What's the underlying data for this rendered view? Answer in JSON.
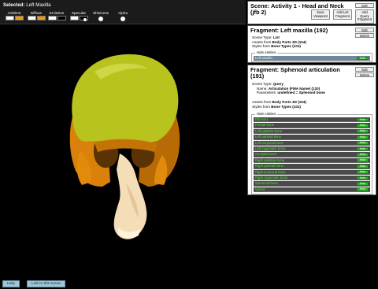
{
  "toolbar": {
    "selected_label": "Selected:",
    "selected_value": "Left Maxilla",
    "materials": [
      {
        "label": "Ambient",
        "colors": [
          "#ffffff",
          "#e99a1b"
        ],
        "has_knob": false
      },
      {
        "label": "Diffuse",
        "colors": [
          "#ffffff",
          "#e99a1b"
        ],
        "has_knob": false
      },
      {
        "label": "Emissive",
        "colors": [
          "#ffffff",
          "#000000"
        ],
        "has_knob": false
      },
      {
        "label": "Specular",
        "colors": [
          "#ffffff",
          "#000000"
        ],
        "has_knob": true
      },
      {
        "label": "Shininess",
        "colors": [],
        "has_knob": true
      },
      {
        "label": "Alpha",
        "colors": [],
        "has_knob": true
      }
    ]
  },
  "bottom": {
    "help_label": "Help",
    "link_label": "Link to this scene"
  },
  "scene": {
    "title_line1": "Scene: Activity 1 - Head and Neck",
    "title_line2": "(jfb 2)",
    "edit_label": "Edit",
    "save_viewpoint_label": [
      "Save",
      "Viewpoint"
    ],
    "add_list_label": [
      "Add List",
      "Fragment"
    ],
    "add_query_label": [
      "Add",
      "Query",
      "Fragment"
    ]
  },
  "fragment_list": {
    "title": "Fragment: Left maxilla (192)",
    "edit_label": "Edit",
    "delete_label": "Delete",
    "scene_type_label": "Scene Type:",
    "scene_type_value": "List",
    "assets_label": "Assets from",
    "assets_value": "Body Parts 3D (104)",
    "styles_label": "Styles from",
    "styles_value": "Bone Types (101)",
    "hide_entities_label": "Hide entities",
    "entities": [
      {
        "name": "Left Maxilla",
        "selected": true,
        "hide_label": "Hide"
      }
    ]
  },
  "fragment_query": {
    "title_line1": "Fragment: Sphenoid articulation",
    "title_line2": "(191)",
    "edit_label": "Edit",
    "delete_label": "Delete",
    "scene_type_label": "Scene Type:",
    "scene_type_value": "Query",
    "name_label": "Name:",
    "name_value": "Articulation (FMA Name) (120)",
    "params_label": "Parameters:",
    "params_value": "undefined = Sphenoid bone",
    "assets_label": "Assets from",
    "assets_value": "Body Parts 3D (104)",
    "styles_label": "Styles from",
    "styles_value": "Bone Types (101)",
    "hide_entities_label": "Hide entities",
    "entities": [
      {
        "name": "Ethmoid",
        "hide_label": "Hide"
      },
      {
        "name": "Frontal bone",
        "hide_label": "Hide"
      },
      {
        "name": "Left palatine bone",
        "hide_label": "Hide"
      },
      {
        "name": "Left parietal bone",
        "hide_label": "Hide"
      },
      {
        "name": "Left temporal bone",
        "hide_label": "Hide"
      },
      {
        "name": "Left zygomatic bone",
        "hide_label": "Hide"
      },
      {
        "name": "Occipital bone",
        "hide_label": "Hide"
      },
      {
        "name": "Right palatine bone",
        "hide_label": "Hide"
      },
      {
        "name": "Right parietal bone",
        "hide_label": "Hide"
      },
      {
        "name": "Right temporal bone",
        "hide_label": "Hide"
      },
      {
        "name": "Right zygomatic bone",
        "hide_label": "Hide"
      },
      {
        "name": "Sphenoid bone",
        "hide_label": "Hide"
      },
      {
        "name": "Vomer",
        "hide_label": "Hide"
      }
    ]
  },
  "colors": {
    "skull_cap": "#b9c31d",
    "skull_side": "#d9810a",
    "maxilla": "#f4ddb7",
    "entity_text": "#52e33a",
    "hide_button": "#2fb52a",
    "selected_row": "#6e87a5",
    "bottom_button": "#9fc6d8"
  },
  "icons": {
    "knob": "white-dot-slider-icon"
  }
}
